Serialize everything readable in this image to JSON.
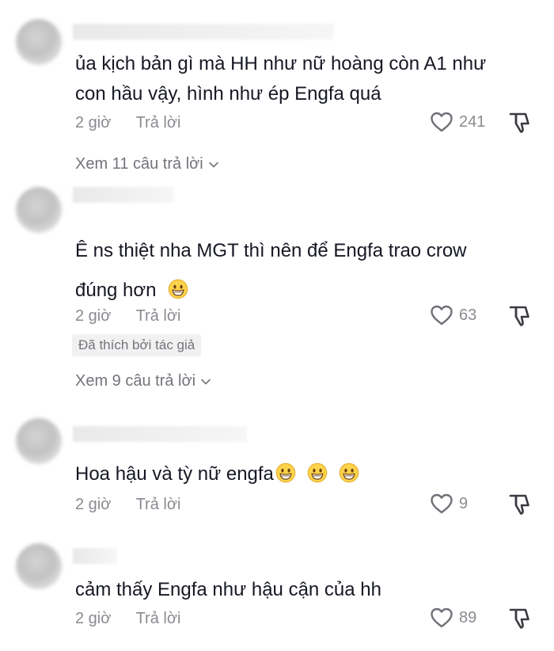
{
  "comments": [
    {
      "text_lines": [
        "ủa kịch bản gì mà HH như nữ hoàng còn A1 như",
        "con hầu vậy, hình như ép Engfa quá"
      ],
      "time": "2 giờ",
      "reply_label": "Trả lời",
      "likes": "241",
      "view_replies": "Xem 11 câu trả lời"
    },
    {
      "text_lines": [
        "Ê ns thiệt nha MGT thì nên để Engfa trao crow",
        "đúng hơn"
      ],
      "time": "2 giờ",
      "reply_label": "Trả lời",
      "likes": "63",
      "badge": "Đã thích bởi tác giả",
      "view_replies": "Xem 9 câu trả lời"
    },
    {
      "text_lines": [
        "Hoa hậu và tỳ nữ engfa"
      ],
      "time": "2 giờ",
      "reply_label": "Trả lời",
      "likes": "9"
    },
    {
      "text_lines": [
        "cảm thấy Engfa như hậu cận của hh"
      ],
      "time": "2 giờ",
      "reply_label": "Trả lời",
      "likes": "89"
    }
  ],
  "icons": {
    "like": "heart-outline-icon",
    "dislike": "thumbs-down-icon",
    "chevron": "chevron-down-icon",
    "emoji": "grinning-face-emoji"
  },
  "colors": {
    "text": "#161823",
    "meta": "#8a8b91",
    "badge_bg": "#f1f1f2"
  }
}
